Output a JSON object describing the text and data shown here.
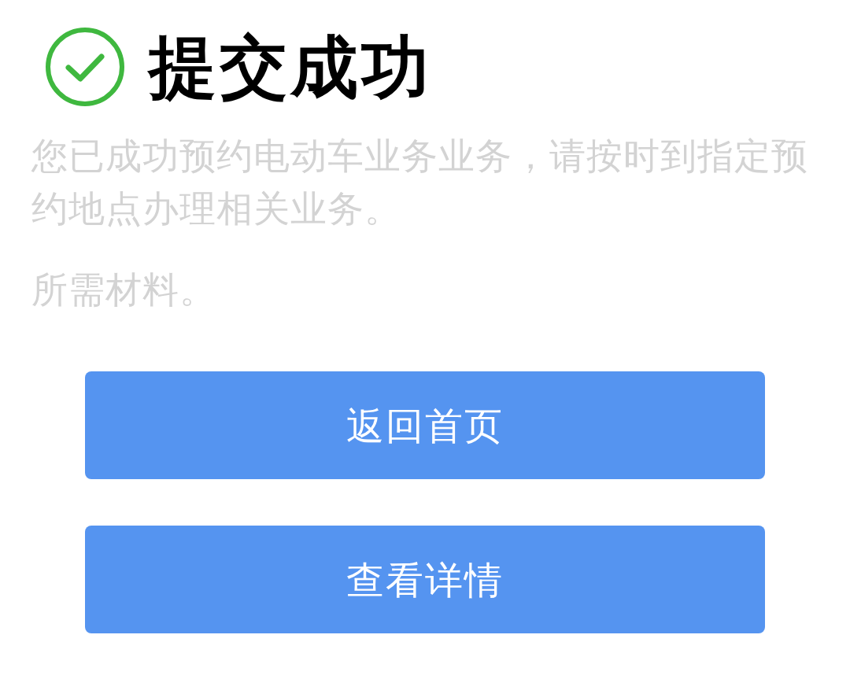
{
  "header": {
    "title": "提交成功"
  },
  "message": "您已成功预约电动车业务业务，请按时到指定预约地点办理相关业务。",
  "materials": "所需材料。",
  "buttons": [
    {
      "label": "返回首页"
    },
    {
      "label": "查看详情"
    }
  ]
}
